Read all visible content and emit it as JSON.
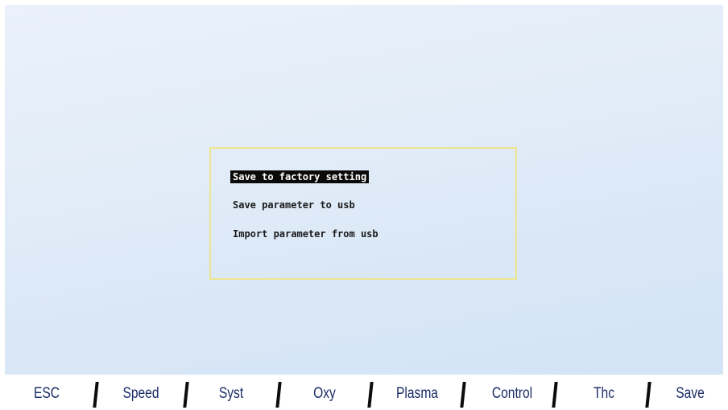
{
  "dialog": {
    "items": [
      {
        "label": "Save to factory setting"
      },
      {
        "label": "Save parameter to usb"
      },
      {
        "label": "Import parameter from usb"
      }
    ]
  },
  "function_keys": [
    {
      "label": "ESC"
    },
    {
      "label": "Speed"
    },
    {
      "label": "Syst"
    },
    {
      "label": "Oxy"
    },
    {
      "label": "Plasma"
    },
    {
      "label": "Control"
    },
    {
      "label": "Thc"
    },
    {
      "label": "Save"
    }
  ],
  "colors": {
    "screen_background": "#dfeaf7",
    "dialog_border": "#efe58e",
    "selected_background": "#0a0a0a",
    "fkey_text": "#1b2c66"
  }
}
